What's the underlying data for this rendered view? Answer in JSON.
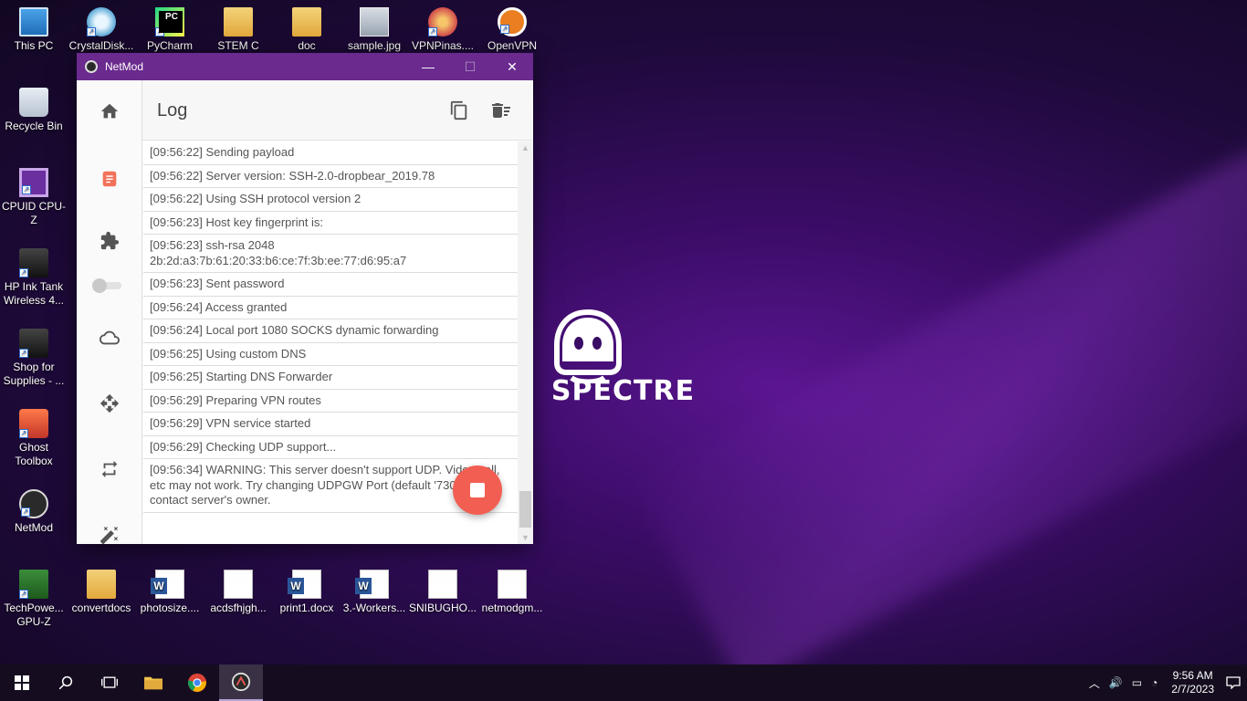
{
  "desktop": {
    "icons": [
      {
        "label": "This PC"
      },
      {
        "label": "CrystalDisk..."
      },
      {
        "label": "PyCharm"
      },
      {
        "label": "STEM C"
      },
      {
        "label": "doc"
      },
      {
        "label": "sample.jpg"
      },
      {
        "label": "VPNPinas...."
      },
      {
        "label": "OpenVPN"
      },
      {
        "label": "Recycle Bin"
      },
      {
        "label": "CPUID CPU-Z"
      },
      {
        "label": "HP Ink Tank Wireless 4..."
      },
      {
        "label": "Shop for Supplies - ..."
      },
      {
        "label": "Ghost Toolbox"
      },
      {
        "label": "NetMod"
      },
      {
        "label": "TechPowe... GPU-Z"
      },
      {
        "label": "convertdocs"
      },
      {
        "label": "photosize...."
      },
      {
        "label": "acdsfhjgh..."
      },
      {
        "label": "print1.docx"
      },
      {
        "label": "3.-Workers..."
      },
      {
        "label": "SNIBUGHO..."
      },
      {
        "label": "netmodgm..."
      }
    ],
    "wallpaper_text": "SPECTRE"
  },
  "window": {
    "title": "NetMod",
    "minimize": "—",
    "maximize": "☐",
    "close": "✕",
    "page_title": "Log",
    "nav": [
      "home-icon",
      "log-icon",
      "extension-icon",
      "cloud-icon",
      "move-icon",
      "repeat-icon",
      "magic-wand-icon"
    ],
    "log": [
      "[09:56:22] Sending payload",
      "[09:56:22] Server version: SSH-2.0-dropbear_2019.78",
      "[09:56:22] Using SSH protocol version 2",
      "[09:56:23] Host key fingerprint is:",
      "[09:56:23] ssh-rsa 2048 2b:2d:a3:7b:61:20:33:b6:ce:7f:3b:ee:77:d6:95:a7",
      "[09:56:23] Sent password",
      "[09:56:24] Access granted",
      "[09:56:24] Local port 1080 SOCKS dynamic forwarding",
      "[09:56:25] Using custom DNS",
      "[09:56:25] Starting DNS Forwarder",
      "[09:56:29] Preparing VPN routes",
      "[09:56:29] VPN service started",
      "[09:56:29] Checking UDP support...",
      "[09:56:34] WARNING: This server doesn't support UDP. Video call, etc may not work. Try changing UDPGW Port (default '7300') or contact server's owner."
    ]
  },
  "taskbar": {
    "time": "9:56 AM",
    "date": "2/7/2023",
    "apps": [
      "start-icon",
      "search-icon",
      "task-view-icon",
      "file-explorer-icon",
      "chrome-icon",
      "netmod-icon"
    ]
  },
  "colors": {
    "titlebar": "#6a2a8e",
    "accent": "#f2715a",
    "fab": "#f25f52"
  }
}
